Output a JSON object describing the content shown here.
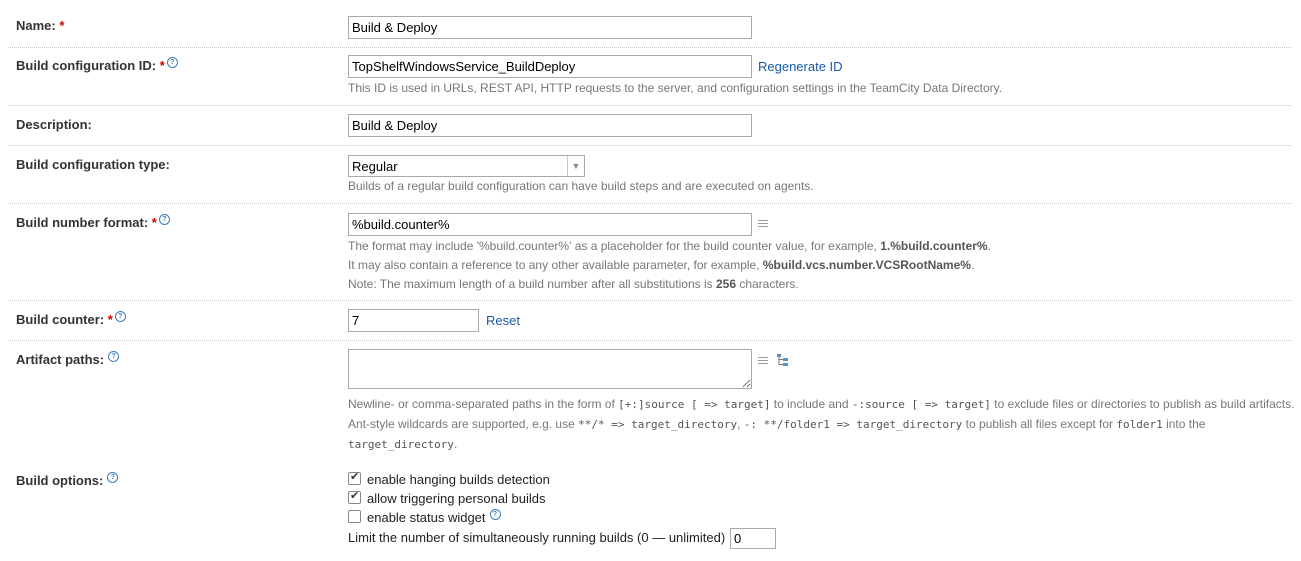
{
  "name": {
    "label": "Name:",
    "required": "*",
    "value": "Build & Deploy"
  },
  "build_config_id": {
    "label": "Build configuration ID:",
    "required": "*",
    "value": "TopShelfWindowsService_BuildDeploy",
    "regenerate_label": "Regenerate ID",
    "note": "This ID is used in URLs, REST API, HTTP requests to the server, and configuration settings in the TeamCity Data Directory."
  },
  "description": {
    "label": "Description:",
    "value": "Build & Deploy"
  },
  "config_type": {
    "label": "Build configuration type:",
    "selected": "Regular",
    "note": "Builds of a regular build configuration can have build steps and are executed on agents."
  },
  "build_number_format": {
    "label": "Build number format:",
    "required": "*",
    "value": "%build.counter%",
    "note1_pre": "The format may include '%build.counter%' as a placeholder for the build counter value, for example, ",
    "note1_bold": "1.%build.counter%",
    "note1_post": ".",
    "note2_pre": "It may also contain a reference to any other available parameter, for example, ",
    "note2_bold": "%build.vcs.number.VCSRootName%",
    "note2_post": ".",
    "note3_pre": "Note: The maximum length of a build number after all substitutions is ",
    "note3_bold": "256",
    "note3_post": " characters."
  },
  "build_counter": {
    "label": "Build counter:",
    "required": "*",
    "value": "7",
    "reset_label": "Reset"
  },
  "artifact_paths": {
    "label": "Artifact paths:",
    "value": "",
    "n1a": "Newline- or comma-separated paths in the form of ",
    "n1b": "[+:]source [ => target]",
    "n1c": " to include and ",
    "n1d": "-:source [ => target]",
    "n1e": " to exclude files or directories to publish as build artifacts.",
    "n2a": "Ant-style wildcards are supported, e.g. use ",
    "n2b": "**/* => target_directory",
    "n2c": ", ",
    "n2d": "-: **/folder1 => target_directory",
    "n2e": " to publish all files except for ",
    "n2f": "folder1",
    "n2g": " into the",
    "n3a": "target_directory",
    "n3b": "."
  },
  "build_options": {
    "label": "Build options:",
    "hanging": {
      "label": "enable hanging builds detection",
      "checked": true
    },
    "personal": {
      "label": "allow triggering personal builds",
      "checked": true
    },
    "status_widget": {
      "label": "enable status widget",
      "checked": false
    },
    "limit_label": "Limit the number of simultaneously running builds (0 — unlimited)",
    "limit_value": "0"
  }
}
